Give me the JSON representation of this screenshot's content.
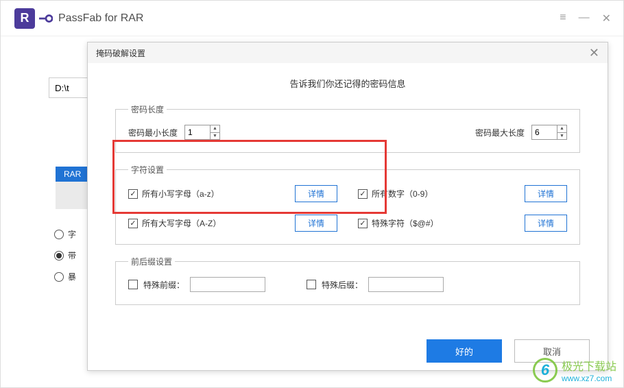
{
  "app": {
    "title": "PassFab for RAR",
    "logo_letter": "R"
  },
  "background": {
    "path_prefix": "D:\\t",
    "tab_label": "RAR",
    "radios": {
      "opt1": "字",
      "opt2": "带",
      "opt3": "暴"
    }
  },
  "modal": {
    "title": "掩码破解设置",
    "instruction": "告诉我们你还记得的密码信息",
    "length_section": {
      "legend": "密码长度",
      "min_label": "密码最小长度",
      "min_value": "1",
      "max_label": "密码最大长度",
      "max_value": "6"
    },
    "char_section": {
      "legend": "字符设置",
      "lowercase": "所有小写字母（a-z）",
      "uppercase": "所有大写字母（A-Z）",
      "digits": "所有数字（0-9）",
      "special": "特殊字符（$@#）",
      "detail_btn": "详情"
    },
    "affix_section": {
      "legend": "前后缀设置",
      "prefix_label": "特殊前缀：",
      "suffix_label": "特殊后缀："
    },
    "buttons": {
      "ok": "好的",
      "cancel": "取消"
    }
  },
  "watermark": {
    "name": "极光下载站",
    "url": "www.xz7.com"
  }
}
